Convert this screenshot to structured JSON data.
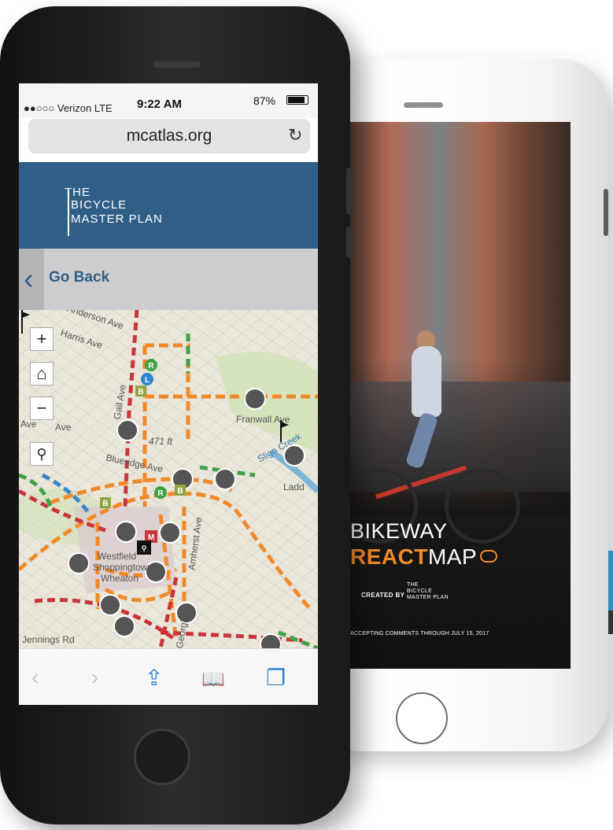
{
  "white_phone": {
    "title_line1": "BIKEWAY",
    "title_react": "REACT",
    "title_map": "MAP",
    "created_by": "CREATED BY",
    "logo_line1": "THE",
    "logo_line2": "BICYCLE",
    "logo_line3": "MASTER PLAN",
    "accepting": "ACCEPTING COMMENTS THROUGH JULY 15, 2017"
  },
  "status_bar": {
    "carrier": "●●○○○ Verizon  LTE",
    "time": "9:22 AM",
    "battery_percent_text": "87%",
    "battery_level": 0.87
  },
  "browser": {
    "url": "mcatlas.org",
    "reload_icon": "reload-icon"
  },
  "site_header": {
    "logo_line1": "THE",
    "logo_line2": "BICYCLE",
    "logo_line3": "MASTER PLAN",
    "bg_color": "#2f5f86"
  },
  "nav": {
    "go_back_label": "Go Back"
  },
  "map": {
    "labels": {
      "anderson": "Anderson Ave",
      "harris": "Harris Ave",
      "ave_left": "Ave",
      "gail": "Gail Ave",
      "ave_mid": "Ave",
      "elevation": "471 ft",
      "franwall": "Franwall Ave",
      "sligo": "Sligo Creek",
      "blueridge": "Blueridge Ave",
      "ladd": "Ladd",
      "westfield": "Westfield",
      "shoppingtown": "Shoppingtown",
      "wheaton": "Wheaton",
      "jennings": "Jennings Rd",
      "georgia": "Georgia",
      "amherst": "Amherst Ave"
    },
    "controls": {
      "zoom_in": "+",
      "home": "⌂",
      "zoom_out": "−",
      "search": "⚲"
    },
    "transit_markers": [
      "R",
      "L",
      "B",
      "R",
      "B",
      "B",
      "M"
    ]
  },
  "toolbar": {
    "back": "‹",
    "forward": "›",
    "share": "⇪",
    "bookmarks": "📖",
    "tabs": "❐"
  },
  "colors": {
    "accent_blue": "#3aa7dc",
    "orange": "#f08a2b",
    "route_red": "#c9363a",
    "route_green": "#3fa247"
  }
}
